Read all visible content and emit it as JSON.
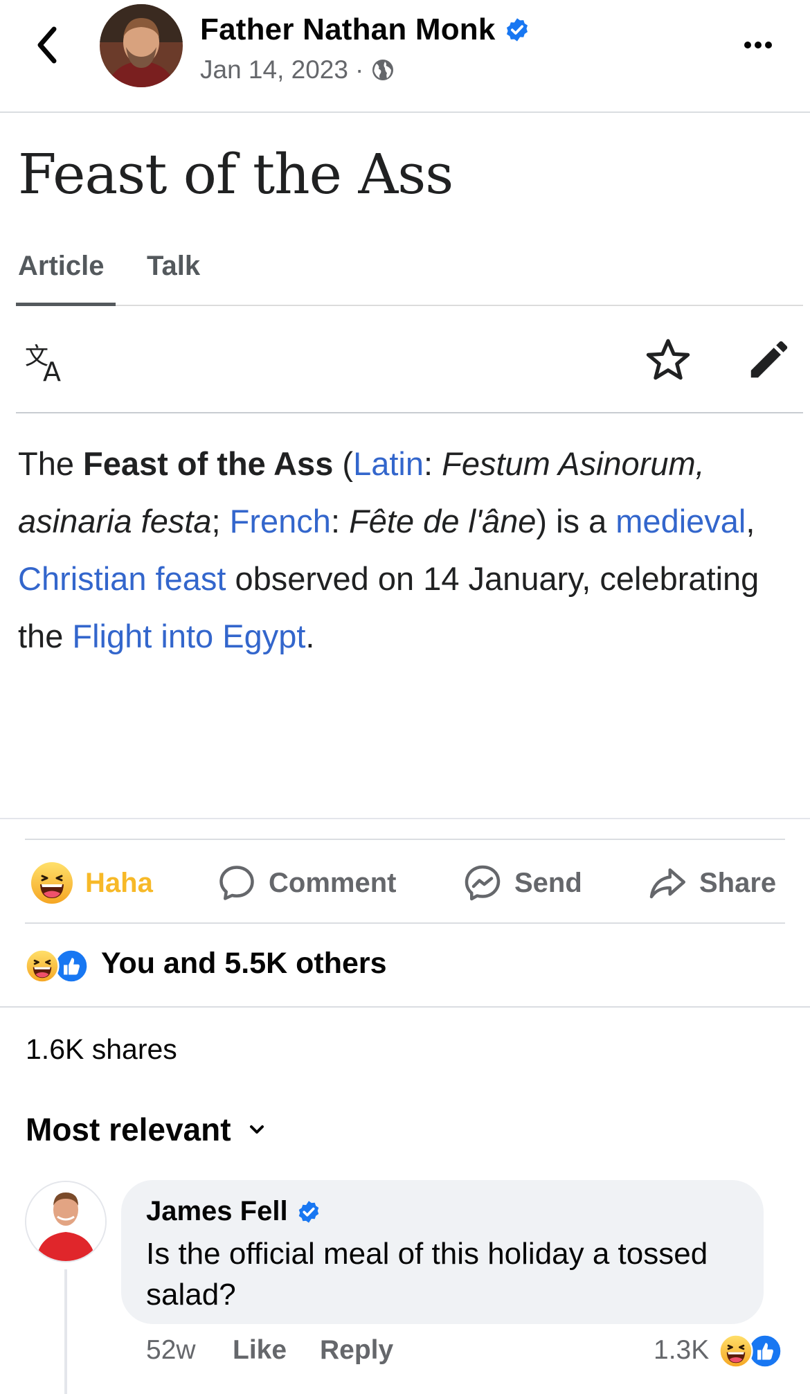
{
  "header": {
    "author": "Father Nathan Monk",
    "date": "Jan 14, 2023",
    "separator": "·"
  },
  "wiki": {
    "title": "Feast of the Ass",
    "tabs": [
      "Article",
      "Talk"
    ],
    "body": {
      "p1": "The ",
      "bold": "Feast of the Ass",
      "p2": " (",
      "link_latin": "Latin",
      "p3": ": ",
      "italic1": "Festum Asinorum, asinaria festa",
      "p4": "; ",
      "link_french": "French",
      "p5": ": ",
      "italic2": "Fête de l'âne",
      "p6": ") is a ",
      "link_medieval": "medieval",
      "p7": ", ",
      "link_feast": "Christian feast",
      "p8": " observed on 14 January, celebrating the ",
      "link_flight": "Flight into Egypt",
      "p9": "."
    }
  },
  "actions": {
    "haha": "Haha",
    "comment": "Comment",
    "send": "Send",
    "share": "Share"
  },
  "reactions": {
    "text": "You and 5.5K others"
  },
  "shares": "1.6K shares",
  "sort": "Most relevant",
  "comment": {
    "author": "James Fell",
    "text": "Is the official meal of this holiday a tossed salad?",
    "age": "52w",
    "like": "Like",
    "reply": "Reply",
    "count": "1.3K"
  },
  "colors": {
    "facebook_blue": "#1877f2",
    "haha_yellow": "#f7b928",
    "wiki_link": "#3366cc",
    "secondary_text": "#65676b"
  },
  "icons": [
    "back-icon",
    "verified-badge-icon",
    "globe-icon",
    "more-icon",
    "translate-icon",
    "star-icon",
    "edit-pencil-icon",
    "haha-emoji-icon",
    "comment-icon",
    "messenger-icon",
    "share-arrow-icon",
    "like-icon",
    "chevron-down-icon"
  ]
}
